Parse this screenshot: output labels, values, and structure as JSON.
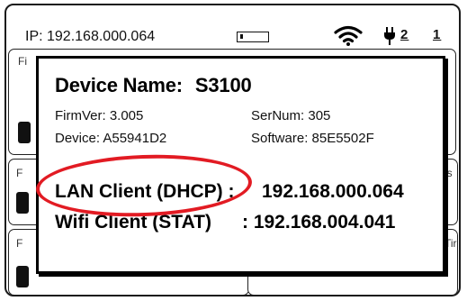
{
  "statusbar": {
    "ip_text": "IP: 192.168.000.064",
    "port_a": "2",
    "port_b": "1",
    "icons": [
      "battery-icon",
      "wifi-icon",
      "plug-icon"
    ]
  },
  "background_tiles": {
    "top_strip_text": "Fi",
    "mid_left_label": "F",
    "mid_right_label": "us",
    "bottom_left_label": "F",
    "bottom_right_label": "Tir"
  },
  "dialog": {
    "device_name_label": "Device Name:",
    "device_name_value": "S3100",
    "firmver": "FirmVer:  3.005",
    "sernum": "SerNum:  305",
    "device": "Device: A55941D2",
    "software": "Software: 85E5502F",
    "lan_label": "LAN Client (DHCP) :",
    "lan_ip": "192.168.000.064",
    "wifi_label": "Wifi Client (STAT)",
    "wifi_ip": ": 192.168.004.041"
  },
  "annotation": {
    "color": "#e21b23"
  }
}
